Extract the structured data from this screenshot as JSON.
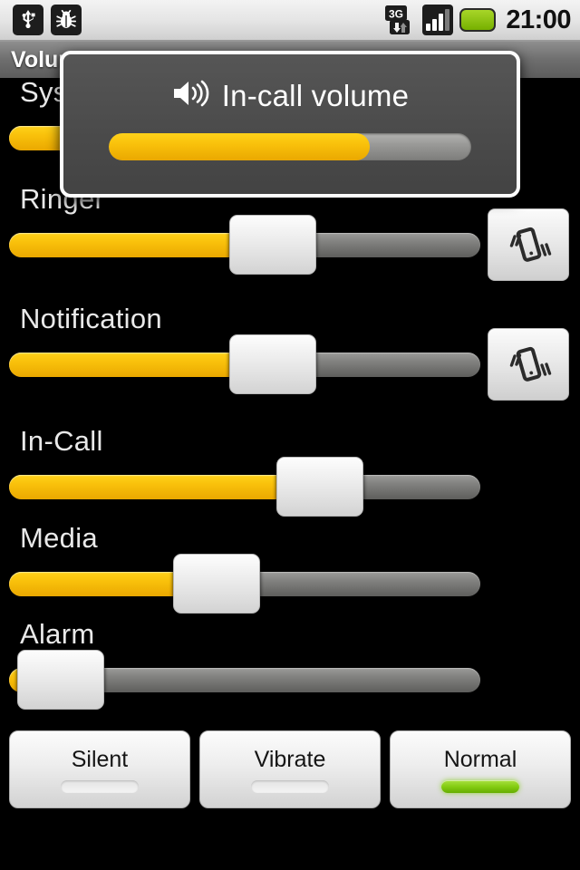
{
  "status_bar": {
    "icons_left": [
      {
        "name": "usb-icon",
        "label": "USB connected"
      },
      {
        "name": "bug-icon",
        "label": "USB debugging connected"
      }
    ],
    "icons_right": [
      {
        "name": "network-3g-icon",
        "label": "3G"
      },
      {
        "name": "signal-strength-icon",
        "label": "Signal"
      },
      {
        "name": "battery-icon",
        "label": "Battery"
      }
    ],
    "network_label": "3G",
    "clock": "21:00"
  },
  "title_bar": {
    "title": "Volume"
  },
  "dialog": {
    "title": "In-call volume",
    "speaker_icon": "volume-up-icon",
    "progress_percent": 72
  },
  "sliders": [
    {
      "key": "system",
      "label": "System",
      "percent": 27,
      "has_vibrate_toggle": false
    },
    {
      "key": "ringer",
      "label": "Ringer",
      "percent": 56,
      "has_vibrate_toggle": true
    },
    {
      "key": "notification",
      "label": "Notification",
      "percent": 56,
      "has_vibrate_toggle": true
    },
    {
      "key": "incall",
      "label": "In-Call",
      "percent": 66,
      "has_vibrate_toggle": false
    },
    {
      "key": "media",
      "label": "Media",
      "percent": 44,
      "has_vibrate_toggle": false
    },
    {
      "key": "alarm",
      "label": "Alarm",
      "percent": 11,
      "has_vibrate_toggle": false
    }
  ],
  "mode_buttons": [
    {
      "key": "silent",
      "label": "Silent",
      "active": false
    },
    {
      "key": "vibrate",
      "label": "Vibrate",
      "active": false
    },
    {
      "key": "normal",
      "label": "Normal",
      "active": true
    }
  ],
  "colors": {
    "accent_yellow": "#f9c10b",
    "track_gray": "#7f7f7d",
    "active_green": "#84cc12",
    "background": "#000000",
    "dialog_bg": "#4b4b4b"
  }
}
